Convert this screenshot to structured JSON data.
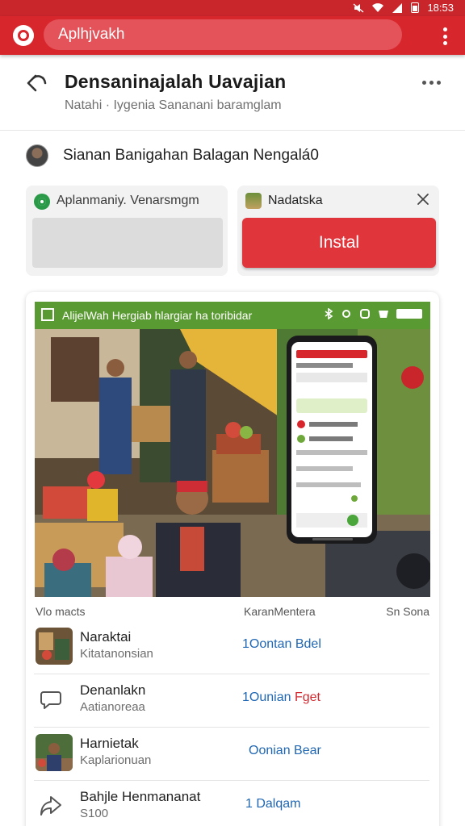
{
  "status_bar": {
    "time": "18:53"
  },
  "app_bar": {
    "search_text": "Aplhjvakh"
  },
  "header": {
    "title": "Densaninajalah Uavajian",
    "subtitle": "Natahi · Iygenia Sananani baramglam"
  },
  "user": {
    "name": "Sianan Banigahan Balagan Nengalá0"
  },
  "cards": {
    "left_label": "Aplanmaniy. Venarsmgm",
    "right_title": "Nadatska",
    "install_label": "Instal"
  },
  "banner": {
    "text": "AlijelWah Hergiab hlargiar ha toribidar"
  },
  "list": {
    "headers": [
      "Vlo macts",
      "KaranMentera",
      "Sn Sona"
    ],
    "rows": [
      {
        "title": "Naraktai",
        "subtitle": "Kitatanonsian",
        "action_part1": "1Oontan",
        "action_part2": "Bdel",
        "action_color2": "#1f66b3"
      },
      {
        "title": "Denanlakn",
        "subtitle": "Aatianoreaa",
        "action_part1": "1Ounian",
        "action_part2": "Fget",
        "action_color2": "#d02a30"
      },
      {
        "title": "Harnietak",
        "subtitle": "Kaplarionuan",
        "action_part1": "Oonian",
        "action_part2": "Bear",
        "action_color2": "#1f66b3"
      },
      {
        "title": "Bahjle Henmananat",
        "subtitle": "S100",
        "action_part1": "1 Dalqam",
        "action_part2": "",
        "action_color2": "#1f66b3"
      }
    ]
  },
  "colors": {
    "brand_red": "#d8262d",
    "banner_green": "#5a9a32",
    "link_blue": "#1f66b3"
  }
}
